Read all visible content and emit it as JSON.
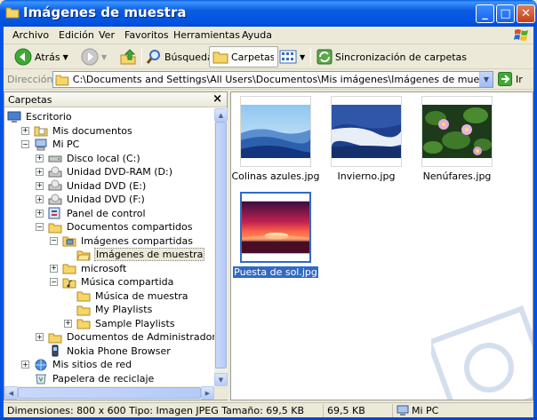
{
  "window": {
    "title": "Imágenes de muestra",
    "minimize_glyph": "_",
    "maximize_glyph": "□",
    "close_glyph": "✕"
  },
  "menu": [
    "Archivo",
    "Edición",
    "Ver",
    "Favoritos",
    "Herramientas",
    "Ayuda"
  ],
  "toolbar": {
    "back_label": "Atrás",
    "search_label": "Búsqueda",
    "folders_label": "Carpetas",
    "sync_label": "Sincronización de carpetas"
  },
  "address": {
    "label": "Dirección",
    "path": "C:\\Documents and Settings\\All Users\\Documentos\\Mis imágenes\\Imágenes de muestra",
    "go_label": "Ir"
  },
  "folders_pane": {
    "title": "Carpetas",
    "close_glyph": "×",
    "tree": [
      {
        "label": "Escritorio",
        "icon": "desktop-icon",
        "expander": ""
      },
      {
        "label": "Mis documentos",
        "icon": "my-documents-icon",
        "expander": "+"
      },
      {
        "label": "Mi PC",
        "icon": "my-computer-icon",
        "expander": "−"
      },
      {
        "label": "Disco local (C:)",
        "icon": "hard-drive-icon",
        "expander": "+"
      },
      {
        "label": "Unidad DVD-RAM (D:)",
        "icon": "dvd-drive-icon",
        "expander": "+"
      },
      {
        "label": "Unidad DVD (E:)",
        "icon": "dvd-drive-icon",
        "expander": "+"
      },
      {
        "label": "Unidad DVD (F:)",
        "icon": "dvd-drive-icon",
        "expander": "+"
      },
      {
        "label": "Panel de control",
        "icon": "control-panel-icon",
        "expander": "+"
      },
      {
        "label": "Documentos compartidos",
        "icon": "folder-icon",
        "expander": "−"
      },
      {
        "label": "Imágenes compartidas",
        "icon": "pictures-folder-icon",
        "expander": "−"
      },
      {
        "label": "Imágenes de muestra",
        "icon": "open-folder-icon",
        "expander": ""
      },
      {
        "label": "microsoft",
        "icon": "folder-icon",
        "expander": "+"
      },
      {
        "label": "Música compartida",
        "icon": "music-folder-icon",
        "expander": "−"
      },
      {
        "label": "Música de muestra",
        "icon": "folder-icon",
        "expander": ""
      },
      {
        "label": "My Playlists",
        "icon": "folder-icon",
        "expander": ""
      },
      {
        "label": "Sample Playlists",
        "icon": "folder-icon",
        "expander": "+"
      },
      {
        "label": "Documentos de Administrador",
        "icon": "folder-icon",
        "expander": "+"
      },
      {
        "label": "Nokia Phone Browser",
        "icon": "phone-icon",
        "expander": ""
      },
      {
        "label": "Mis sitios de red",
        "icon": "network-places-icon",
        "expander": "+"
      },
      {
        "label": "Papelera de reciclaje",
        "icon": "recycle-bin-icon",
        "expander": ""
      }
    ]
  },
  "files": [
    {
      "name": "Colinas azules.jpg",
      "icon": "blue-hills-thumbnail"
    },
    {
      "name": "Invierno.jpg",
      "icon": "winter-thumbnail"
    },
    {
      "name": "Nenúfares.jpg",
      "icon": "water-lilies-thumbnail"
    },
    {
      "name": "Puesta de sol.jpg",
      "icon": "sunset-thumbnail",
      "selected": true
    }
  ],
  "status": {
    "info": "Dimensiones: 800 x 600 Tipo: Imagen JPEG Tamaño: 69,5 KB",
    "size": "69,5 KB",
    "location": "Mi PC"
  },
  "colors": {
    "titlebar": "#0054e3",
    "selection": "#316ac5",
    "chrome": "#ece9d8"
  }
}
